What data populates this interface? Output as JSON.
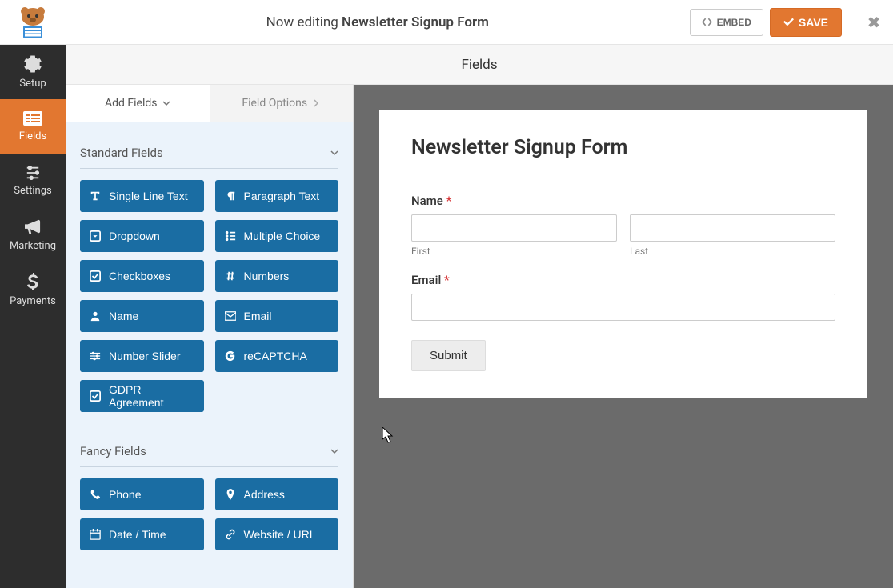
{
  "header": {
    "editing_prefix": "Now editing ",
    "form_name": "Newsletter Signup Form",
    "embed_label": "EMBED",
    "save_label": "SAVE"
  },
  "sidenav": {
    "setup": "Setup",
    "fields": "Fields",
    "settings": "Settings",
    "marketing": "Marketing",
    "payments": "Payments"
  },
  "center": {
    "title": "Fields",
    "tabs": {
      "add": "Add Fields",
      "options": "Field Options"
    }
  },
  "groups": {
    "standard": {
      "title": "Standard Fields",
      "items": [
        "Single Line Text",
        "Paragraph Text",
        "Dropdown",
        "Multiple Choice",
        "Checkboxes",
        "Numbers",
        "Name",
        "Email",
        "Number Slider",
        "reCAPTCHA",
        "GDPR Agreement"
      ]
    },
    "fancy": {
      "title": "Fancy Fields",
      "items": [
        "Phone",
        "Address",
        "Date / Time",
        "Website / URL"
      ]
    }
  },
  "form": {
    "title": "Newsletter Signup Form",
    "name_label": "Name",
    "first_sub": "First",
    "last_sub": "Last",
    "email_label": "Email",
    "submit_label": "Submit"
  }
}
